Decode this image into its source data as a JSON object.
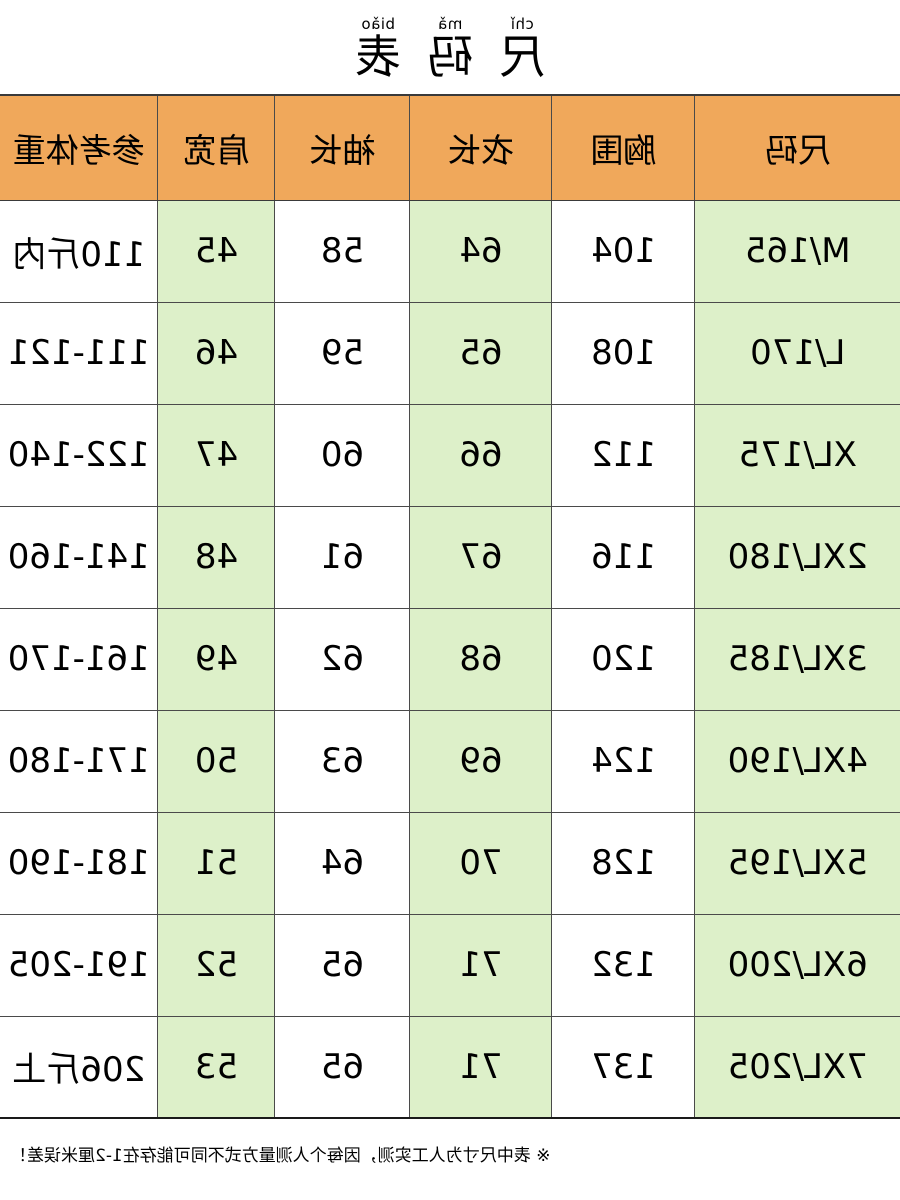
{
  "page": {
    "background_color": "#ffffff",
    "mirrored": true
  },
  "title": {
    "full_text": "尺码表",
    "characters": [
      {
        "char": "尺",
        "pinyin": "chǐ"
      },
      {
        "char": "码",
        "pinyin": "mǎ"
      },
      {
        "char": "表",
        "pinyin": "biǎo"
      }
    ]
  },
  "table": {
    "header_color": "#F0A85B",
    "shaded_cell_color": "#DDF0C9",
    "plain_cell_color": "#FFFFFF",
    "border_color": "#4A4A4A",
    "columns": [
      {
        "key": "size",
        "label": "尺码",
        "shaded": true
      },
      {
        "key": "bust",
        "label": "胸围",
        "shaded": false
      },
      {
        "key": "length",
        "label": "衣长",
        "shaded": true
      },
      {
        "key": "sleeve",
        "label": "袖长",
        "shaded": false
      },
      {
        "key": "shoulder",
        "label": "肩宽",
        "shaded": true
      },
      {
        "key": "weight",
        "label": "参考体重",
        "shaded": false
      }
    ],
    "rows": [
      {
        "size": "M/165",
        "bust": "104",
        "length": "64",
        "sleeve": "58",
        "shoulder": "45",
        "weight": "110斤内"
      },
      {
        "size": "L/170",
        "bust": "108",
        "length": "65",
        "sleeve": "59",
        "shoulder": "46",
        "weight": "111-121"
      },
      {
        "size": "XL/175",
        "bust": "112",
        "length": "66",
        "sleeve": "60",
        "shoulder": "47",
        "weight": "122-140"
      },
      {
        "size": "2XL/180",
        "bust": "116",
        "length": "67",
        "sleeve": "61",
        "shoulder": "48",
        "weight": "141-160"
      },
      {
        "size": "3XL/185",
        "bust": "120",
        "length": "68",
        "sleeve": "62",
        "shoulder": "49",
        "weight": "161-170"
      },
      {
        "size": "4XL/190",
        "bust": "124",
        "length": "69",
        "sleeve": "63",
        "shoulder": "50",
        "weight": "171-180"
      },
      {
        "size": "5XL/195",
        "bust": "128",
        "length": "70",
        "sleeve": "64",
        "shoulder": "51",
        "weight": "181-190"
      },
      {
        "size": "6XL/200",
        "bust": "132",
        "length": "71",
        "sleeve": "65",
        "shoulder": "52",
        "weight": "191-205"
      },
      {
        "size": "7XL/205",
        "bust": "137",
        "length": "71",
        "sleeve": "65",
        "shoulder": "53",
        "weight": "206斤上"
      }
    ]
  },
  "footnote": {
    "text": "※ 表中尺寸为人工实测，因每个人测量方式不同可能存在1-2厘米误差！"
  }
}
